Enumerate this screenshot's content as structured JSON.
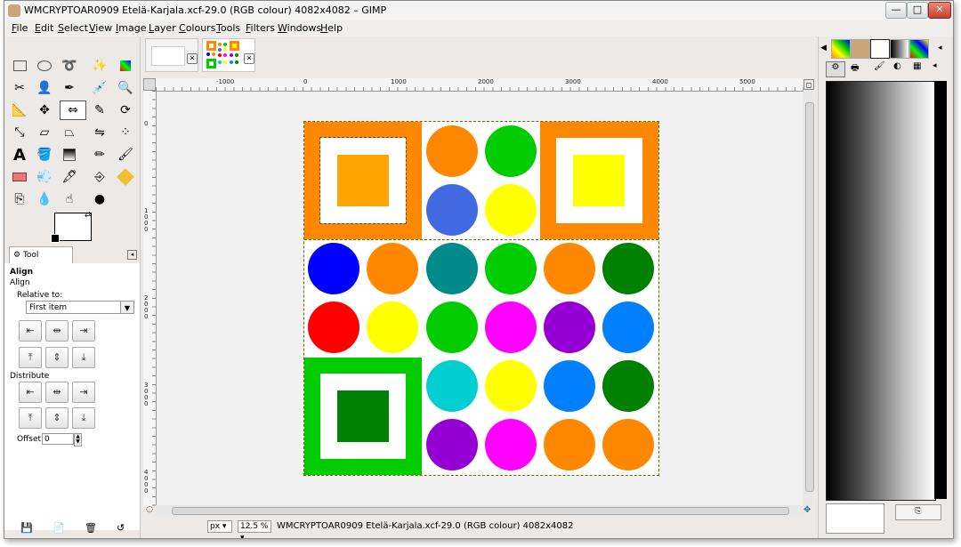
{
  "window": {
    "title": "WMCRYPTOAR0909 Etelä-Karjala.xcf-29.0 (RGB colour) 4082x4082 – GIMP",
    "minimize": "—",
    "maximize": "□",
    "close": "✕"
  },
  "menubar": {
    "items": [
      "File",
      "Edit",
      "Select",
      "View",
      "Image",
      "Layer",
      "Colours",
      "Tools",
      "Filters",
      "Windows",
      "Help"
    ]
  },
  "toolbox": {
    "tool_options_tab": "Tool Options",
    "panel_title": "Align",
    "subtitle": "Align",
    "relative_to_label": "Relative to:",
    "relative_to_value": "First item",
    "distribute_label": "Distribute",
    "offset_label": "Offset:",
    "offset_value": "0"
  },
  "rulers": {
    "horizontal_labels": [
      "-1000",
      "0",
      "1000",
      "2000",
      "3000",
      "4000",
      "5000"
    ],
    "vertical_labels": [
      "0",
      "1000",
      "2000",
      "3000",
      "4000"
    ]
  },
  "statusbar": {
    "unit": "px",
    "zoom": "12.5 %",
    "info": "WMCRYPTOAR0909 Etelä-Karjala.xcf-29.0 (RGB colour) 4082x4082"
  },
  "colors": {
    "orange": "#ff8800",
    "amber": "#ffa500",
    "green": "#00cc00",
    "dark_green": "#008000",
    "yellow": "#ffff00",
    "royal_blue": "#4169e1",
    "blue": "#0000ff",
    "teal": "#008b8b",
    "red": "#ff0000",
    "magenta": "#ff00ff",
    "purple": "#9400d3",
    "azure": "#0080ff",
    "cyan": "#00ced1"
  }
}
